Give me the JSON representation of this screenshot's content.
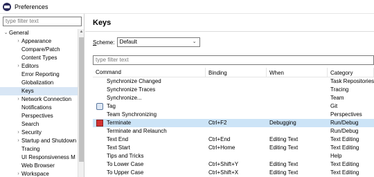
{
  "window": {
    "title": "Preferences"
  },
  "left": {
    "filter_placeholder": "type filter text",
    "tree": [
      {
        "label": "General",
        "twisty": "⌄",
        "indent": 0
      },
      {
        "label": "Appearance",
        "twisty": "›",
        "indent": 1
      },
      {
        "label": "Compare/Patch",
        "twisty": "",
        "indent": 1
      },
      {
        "label": "Content Types",
        "twisty": "",
        "indent": 1
      },
      {
        "label": "Editors",
        "twisty": "›",
        "indent": 1
      },
      {
        "label": "Error Reporting",
        "twisty": "",
        "indent": 1
      },
      {
        "label": "Globalization",
        "twisty": "",
        "indent": 1
      },
      {
        "label": "Keys",
        "twisty": "",
        "indent": 1,
        "selected": true
      },
      {
        "label": "Network Connection",
        "twisty": "›",
        "indent": 1
      },
      {
        "label": "Notifications",
        "twisty": "",
        "indent": 1
      },
      {
        "label": "Perspectives",
        "twisty": "",
        "indent": 1
      },
      {
        "label": "Search",
        "twisty": "",
        "indent": 1
      },
      {
        "label": "Security",
        "twisty": "›",
        "indent": 1
      },
      {
        "label": "Startup and Shutdown",
        "twisty": "›",
        "indent": 1
      },
      {
        "label": "Tracing",
        "twisty": "",
        "indent": 1
      },
      {
        "label": "UI Responsiveness M",
        "twisty": "",
        "indent": 1
      },
      {
        "label": "Web Browser",
        "twisty": "",
        "indent": 1
      },
      {
        "label": "Workspace",
        "twisty": "›",
        "indent": 1
      }
    ]
  },
  "right": {
    "title": "Keys",
    "scheme_label_prefix": "S",
    "scheme_label_rest": "cheme:",
    "scheme_value": "Default",
    "filter_placeholder": "type filter text",
    "columns": [
      "Command",
      "Binding",
      "When",
      "Category"
    ],
    "rows": [
      {
        "command": "Synchronize Changed",
        "binding": "",
        "when": "",
        "category": "Task Repositories",
        "icon": ""
      },
      {
        "command": "Synchronize Traces",
        "binding": "",
        "when": "",
        "category": "Tracing",
        "icon": ""
      },
      {
        "command": "Synchronize...",
        "binding": "",
        "when": "",
        "category": "Team",
        "icon": ""
      },
      {
        "command": "Tag",
        "binding": "",
        "when": "",
        "category": "Git",
        "icon": "tag-icon"
      },
      {
        "command": "Team Synchronizing",
        "binding": "",
        "when": "",
        "category": "Perspectives",
        "icon": ""
      },
      {
        "command": "Terminate",
        "binding": "Ctrl+F2",
        "when": "Debugging",
        "category": "Run/Debug",
        "icon": "terminate-icon",
        "selected": true
      },
      {
        "command": "Terminate and Relaunch",
        "binding": "",
        "when": "",
        "category": "Run/Debug",
        "icon": ""
      },
      {
        "command": "Text End",
        "binding": "Ctrl+End",
        "when": "Editing Text",
        "category": "Text Editing",
        "icon": ""
      },
      {
        "command": "Text Start",
        "binding": "Ctrl+Home",
        "when": "Editing Text",
        "category": "Text Editing",
        "icon": ""
      },
      {
        "command": "Tips and Tricks",
        "binding": "",
        "when": "",
        "category": "Help",
        "icon": ""
      },
      {
        "command": "To Lower Case",
        "binding": "Ctrl+Shift+Y",
        "when": "Editing Text",
        "category": "Text Editing",
        "icon": ""
      },
      {
        "command": "To Upper Case",
        "binding": "Ctrl+Shift+X",
        "when": "Editing Text",
        "category": "Text Editing",
        "icon": ""
      }
    ]
  },
  "colors": {
    "selection": "#cce4f7",
    "tree_selection": "#d8e6f5"
  }
}
